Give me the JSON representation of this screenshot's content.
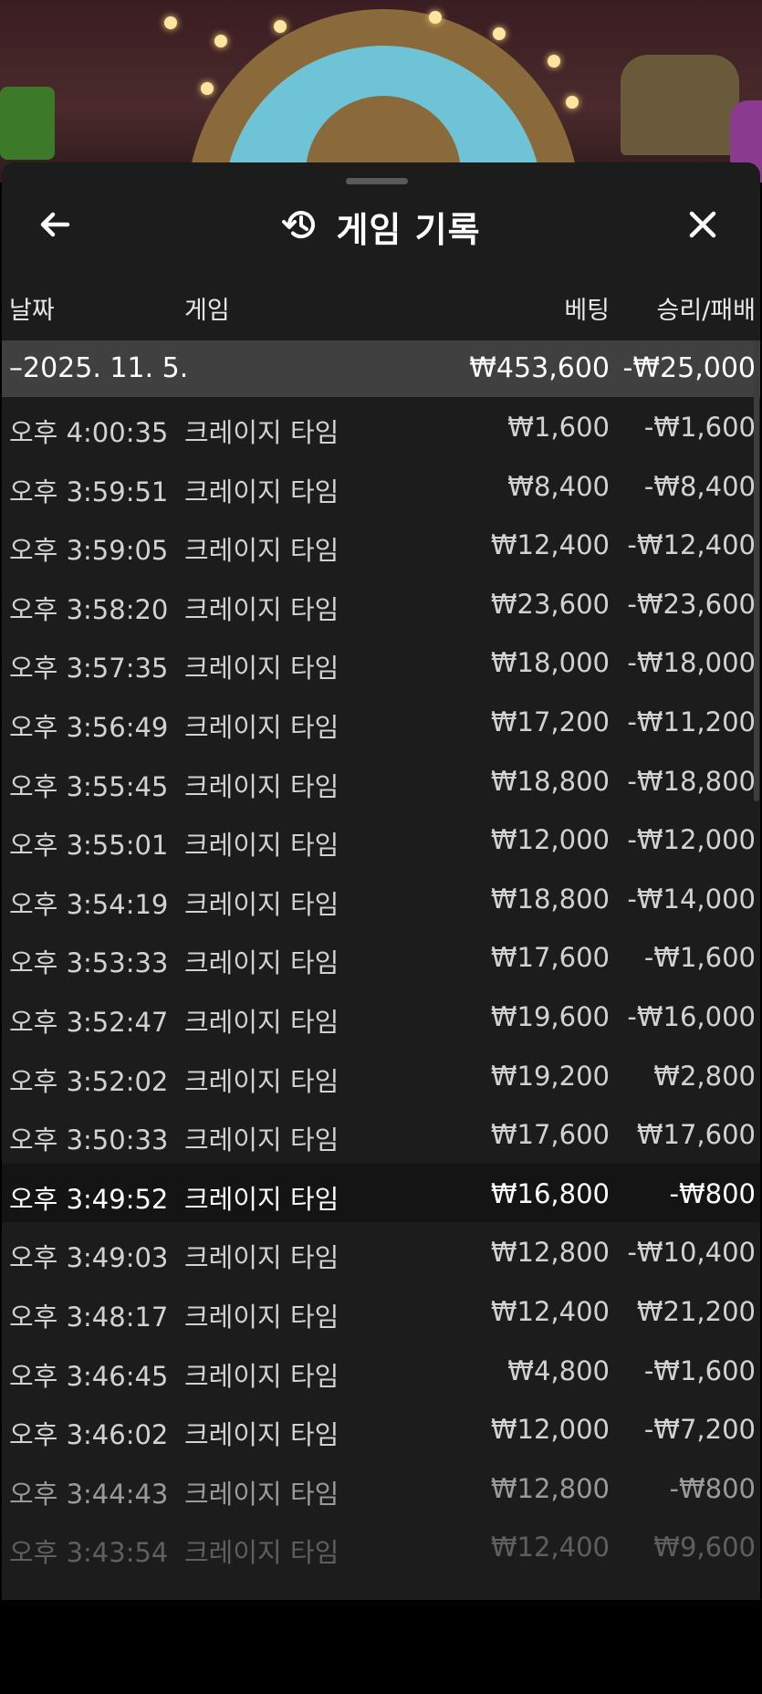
{
  "header": {
    "title": "게임 기록"
  },
  "columns": {
    "date": "날짜",
    "game": "게임",
    "bet": "베팅",
    "result": "승리/패배"
  },
  "group": {
    "date": "–2025. 11. 5.",
    "bet_total": "₩453,600",
    "result_total": "-₩25,000"
  },
  "rows": [
    {
      "time": "오후 4:00:35",
      "game": "크레이지 타임",
      "bet": "₩1,600",
      "result": "-₩1,600"
    },
    {
      "time": "오후 3:59:51",
      "game": "크레이지 타임",
      "bet": "₩8,400",
      "result": "-₩8,400"
    },
    {
      "time": "오후 3:59:05",
      "game": "크레이지 타임",
      "bet": "₩12,400",
      "result": "-₩12,400"
    },
    {
      "time": "오후 3:58:20",
      "game": "크레이지 타임",
      "bet": "₩23,600",
      "result": "-₩23,600"
    },
    {
      "time": "오후 3:57:35",
      "game": "크레이지 타임",
      "bet": "₩18,000",
      "result": "-₩18,000"
    },
    {
      "time": "오후 3:56:49",
      "game": "크레이지 타임",
      "bet": "₩17,200",
      "result": "-₩11,200"
    },
    {
      "time": "오후 3:55:45",
      "game": "크레이지 타임",
      "bet": "₩18,800",
      "result": "-₩18,800"
    },
    {
      "time": "오후 3:55:01",
      "game": "크레이지 타임",
      "bet": "₩12,000",
      "result": "-₩12,000"
    },
    {
      "time": "오후 3:54:19",
      "game": "크레이지 타임",
      "bet": "₩18,800",
      "result": "-₩14,000"
    },
    {
      "time": "오후 3:53:33",
      "game": "크레이지 타임",
      "bet": "₩17,600",
      "result": "-₩1,600"
    },
    {
      "time": "오후 3:52:47",
      "game": "크레이지 타임",
      "bet": "₩19,600",
      "result": "-₩16,000"
    },
    {
      "time": "오후 3:52:02",
      "game": "크레이지 타임",
      "bet": "₩19,200",
      "result": "₩2,800"
    },
    {
      "time": "오후 3:50:33",
      "game": "크레이지 타임",
      "bet": "₩17,600",
      "result": "₩17,600"
    },
    {
      "time": "오후 3:49:52",
      "game": "크레이지 타임",
      "bet": "₩16,800",
      "result": "-₩800"
    },
    {
      "time": "오후 3:49:03",
      "game": "크레이지 타임",
      "bet": "₩12,800",
      "result": "-₩10,400"
    },
    {
      "time": "오후 3:48:17",
      "game": "크레이지 타임",
      "bet": "₩12,400",
      "result": "₩21,200"
    },
    {
      "time": "오후 3:46:45",
      "game": "크레이지 타임",
      "bet": "₩4,800",
      "result": "-₩1,600"
    },
    {
      "time": "오후 3:46:02",
      "game": "크레이지 타임",
      "bet": "₩12,000",
      "result": "-₩7,200"
    },
    {
      "time": "오후 3:44:43",
      "game": "크레이지 타임",
      "bet": "₩12,800",
      "result": "-₩800"
    },
    {
      "time": "오후 3:43:54",
      "game": "크레이지 타임",
      "bet": "₩12,400",
      "result": "₩9,600"
    }
  ],
  "icons": {
    "back": "arrow-left-icon",
    "history": "history-icon",
    "close": "close-icon"
  }
}
